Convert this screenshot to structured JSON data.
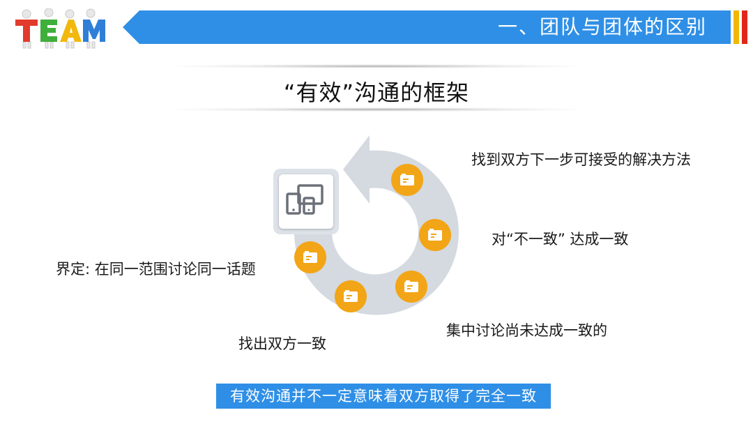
{
  "header": {
    "logo_text": "TEAM",
    "section_title": "一、团队与团体的区别",
    "banner_color": "#2f8fe6",
    "accent_colors": [
      "#f2b705",
      "#e0261a"
    ]
  },
  "slide": {
    "title": "“有效”沟通的框架"
  },
  "diagram": {
    "center_icon": "devices-icon",
    "step_icon": "card-icon",
    "ring_color": "#d5d9e0",
    "dot_color": "#f2a516"
  },
  "labels": {
    "define": "界定: 在同一范围讨论同一话题",
    "find_common": "找出双方一致",
    "focus_disagree": "集中讨论尚未达成一致的",
    "agree_disagree": "对“不一致” 达成一致",
    "next_step": "找到双方下一步可接受的解决方法"
  },
  "footer": {
    "note": "有效沟通并不一定意味着双方取得了完全一致"
  }
}
